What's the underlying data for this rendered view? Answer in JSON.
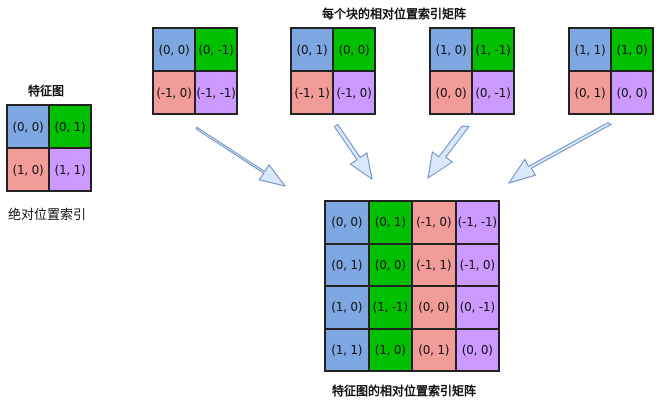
{
  "colors": {
    "blue": "#7ea6e0",
    "green": "#00c000",
    "red": "#f19c99",
    "purple": "#cc99ff",
    "arrow_fill": "#dae8fc",
    "arrow_stroke": "#6c8ebf"
  },
  "labels": {
    "feature_map": "特征图",
    "absolute_index": "绝对位置索引",
    "per_block": "每个块的相对位置索引矩阵",
    "feature_map_matrix": "特征图的相对位置索引矩阵"
  },
  "feature_map": [
    [
      "(0, 0)",
      "(0, 1)"
    ],
    [
      "(1, 0)",
      "(1, 1)"
    ]
  ],
  "blocks": [
    [
      [
        "(0, 0)",
        "(0, -1)"
      ],
      [
        "(-1, 0)",
        "(-1, -1)"
      ]
    ],
    [
      [
        "(0, 1)",
        "(0, 0)"
      ],
      [
        "(-1, 1)",
        "(-1, 0)"
      ]
    ],
    [
      [
        "(1, 0)",
        "(1, -1)"
      ],
      [
        "(0, 0)",
        "(0, -1)"
      ]
    ],
    [
      [
        "(1, 1)",
        "(1, 0)"
      ],
      [
        "(0, 1)",
        "(0, 0)"
      ]
    ]
  ],
  "matrix": [
    [
      "(0, 0)",
      "(0, 1)",
      "(-1, 0)",
      "(-1, -1)"
    ],
    [
      "(0, 1)",
      "(0, 0)",
      "(-1, 1)",
      "(-1, 0)"
    ],
    [
      "(1, 0)",
      "(1, -1)",
      "(0, 0)",
      "(0, -1)"
    ],
    [
      "(1, 1)",
      "(1, 0)",
      "(0, 1)",
      "(0, 0)"
    ]
  ]
}
